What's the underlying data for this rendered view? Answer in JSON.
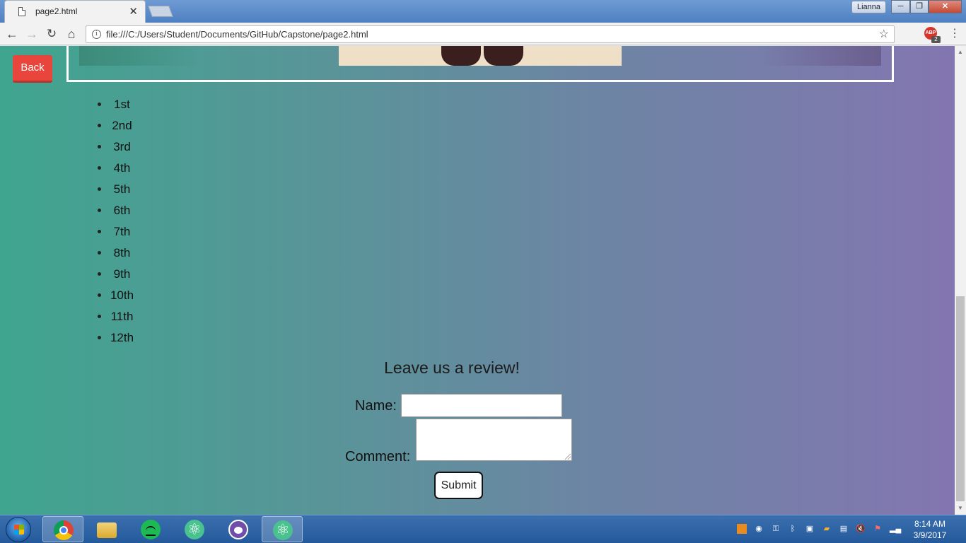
{
  "browser": {
    "tab_title": "page2.html",
    "tab_close": "✕",
    "user_name": "Lianna",
    "url": "file:///C:/Users/Student/Documents/GitHub/Capstone/page2.html",
    "abp_label": "ABP",
    "abp_count": "2",
    "win_min": "─",
    "win_max": "❐",
    "win_close": "✕"
  },
  "toolbar": {
    "back_icon": "←",
    "forward_icon": "→",
    "reload_icon": "↻",
    "home_icon": "⌂",
    "info_icon": "i",
    "star_icon": "☆",
    "menu_icon": "⋮"
  },
  "page": {
    "back_label": "Back",
    "grades": [
      "1st",
      "2nd",
      "3rd",
      "4th",
      "5th",
      "6th",
      "7th",
      "8th",
      "9th",
      "10th",
      "11th",
      "12th"
    ],
    "review": {
      "title": "Leave us a review!",
      "name_label": "Name:",
      "comment_label": "Comment:",
      "name_value": "",
      "comment_value": "",
      "submit_label": "Submit"
    },
    "background_gradient": [
      "#3fa58f",
      "#8376b0"
    ],
    "back_button_color": "#e8453c"
  },
  "taskbar": {
    "apps": [
      "chrome-icon",
      "file-explorer-icon",
      "spotify-icon",
      "atom-icon",
      "github-desktop-icon",
      "atom-icon"
    ],
    "time": "8:14 AM",
    "date": "3/9/2017"
  }
}
